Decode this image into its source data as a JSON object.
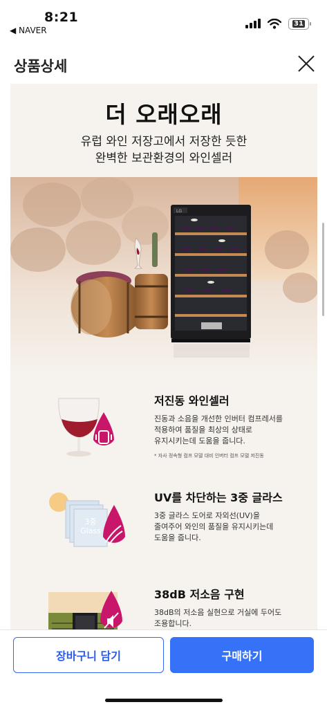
{
  "status_bar": {
    "time": "8:21",
    "back_app": "◀ NAVER",
    "battery": "31"
  },
  "header": {
    "title": "상품상세"
  },
  "hero": {
    "title": "더 오래오래",
    "subtitle_line1": "유럽 와인 저장고에서 저장한 듯한",
    "subtitle_line2": "완벽한 보관환경의 와인셀러",
    "product_logo": "LG"
  },
  "features": [
    {
      "title": "저진동 와인셀러",
      "desc_line1": "진동과 소음을 개선한 인버터 컴프레서를",
      "desc_line2": "적용하여 품질을 최상의 상태로",
      "desc_line3": "유지시키는데 도움을 줍니다.",
      "note": "* 자사 정속형 컴프 모델 대비 인버터 컴프 모델 저진동"
    },
    {
      "title": "UV를 차단하는 3중 글라스",
      "desc_line1": "3중 글라스 도어로 자외선(UV)을",
      "desc_line2": "줄여주어 와인의 품질을 유지시키는데",
      "desc_line3": "도움을 줍니다.",
      "icon_label_1": "3중",
      "icon_label_2": "Glass"
    },
    {
      "title": "38dB 저소음 구현",
      "desc_line1": "38dB의 저소음 실현으로 거실에 두어도",
      "desc_line2": "조용합니다."
    }
  ],
  "actions": {
    "cart_label": "장바구니 담기",
    "buy_label": "구매하기"
  },
  "colors": {
    "accent": "#3672f8",
    "badge": "#c8176a"
  }
}
